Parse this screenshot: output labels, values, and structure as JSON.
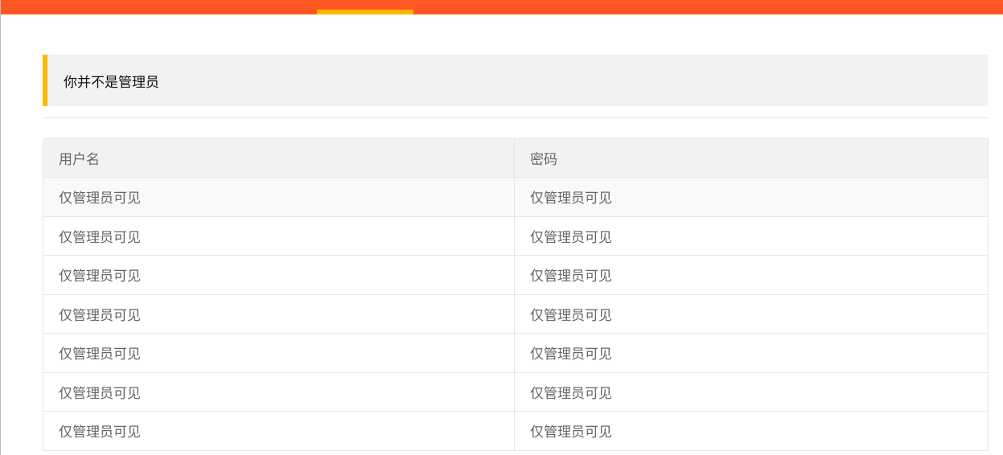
{
  "notice": {
    "text": "你并不是管理员"
  },
  "table": {
    "headers": [
      "用户名",
      "密码"
    ],
    "rows": [
      [
        "仅管理员可见",
        "仅管理员可见"
      ],
      [
        "仅管理员可见",
        "仅管理员可见"
      ],
      [
        "仅管理员可见",
        "仅管理员可见"
      ],
      [
        "仅管理员可见",
        "仅管理员可见"
      ],
      [
        "仅管理员可见",
        "仅管理员可见"
      ],
      [
        "仅管理员可见",
        "仅管理员可见"
      ],
      [
        "仅管理员可见",
        "仅管理员可见"
      ]
    ]
  },
  "colors": {
    "topbar": "#ff5722",
    "accent": "#ffb800",
    "notice_bg": "#f2f2f2",
    "table_text": "#666666"
  }
}
